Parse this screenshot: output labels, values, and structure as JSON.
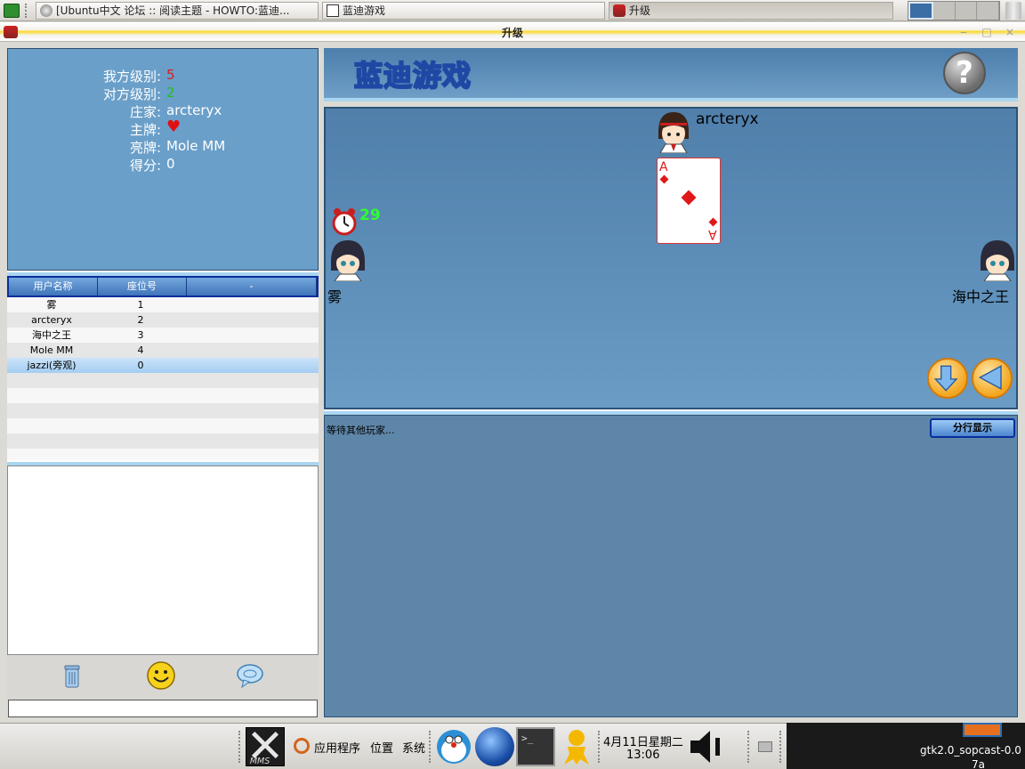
{
  "taskbar": {
    "tasks": [
      {
        "label": "[Ubuntu中文 论坛 :: 阅读主题 - HOWTO:蓝迪..."
      },
      {
        "label": "蓝迪游戏"
      },
      {
        "label": "升级"
      }
    ]
  },
  "window": {
    "title": "升级",
    "minimize": "‒",
    "maximize": "□",
    "close": "×"
  },
  "info": {
    "my_level_label": "我方级别:",
    "my_level": "5",
    "opp_level_label": "对方级别:",
    "opp_level": "2",
    "dealer_label": "庄家:",
    "dealer": "arcteryx",
    "trump_label": "主牌:",
    "shown_label": "亮牌:",
    "shown": "Mole MM",
    "score_label": "得分:",
    "score": "0"
  },
  "user_table": {
    "headers": [
      "用户名称",
      "座位号",
      "-"
    ],
    "rows": [
      {
        "name": "雾",
        "seat": "1"
      },
      {
        "name": "arcteryx",
        "seat": "2"
      },
      {
        "name": "海中之王",
        "seat": "3"
      },
      {
        "name": "Mole MM",
        "seat": "4"
      },
      {
        "name": "jazzi(旁观)",
        "seat": "0"
      }
    ]
  },
  "game": {
    "logo": "蓝迪游戏",
    "help": "?",
    "top_player": "arcteryx",
    "left_player": "雾",
    "right_player": "海中之王",
    "timer": "29",
    "card_rank": "A"
  },
  "messages": {
    "status": "等待其他玩家...",
    "split_button": "分行显示"
  },
  "bottom_panel": {
    "apps": "应用程序",
    "places": "位置",
    "system": "系统",
    "date": "4月11日星期二",
    "time": "13:06",
    "tray_task_line1": "gtk2.0_sopcast-0.0",
    "tray_task_line2": "7a"
  },
  "colors": {
    "my_level": "#d42020",
    "opp_level": "#20c020",
    "trump_heart": "#e01010",
    "accent_blue": "#6a9fc9"
  }
}
